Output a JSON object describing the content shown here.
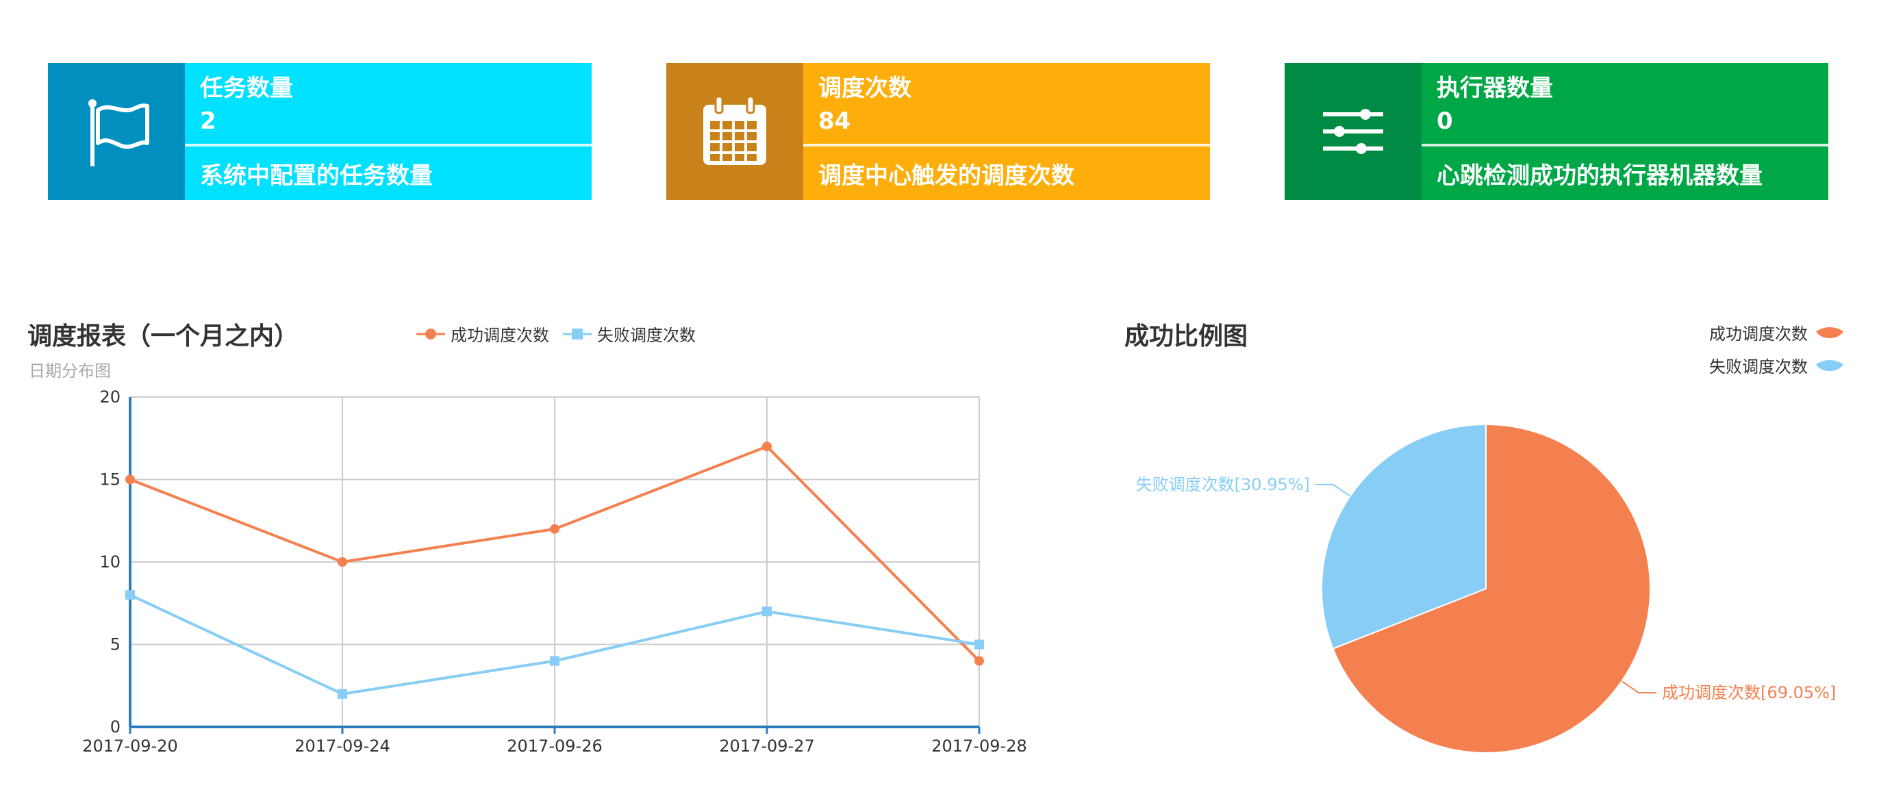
{
  "info_boxes": [
    {
      "title": "任务数量",
      "value": "2",
      "desc": "系统中配置的任务数量",
      "icon": "flag-icon"
    },
    {
      "title": "调度次数",
      "value": "84",
      "desc": "调度中心触发的调度次数",
      "icon": "calendar-icon"
    },
    {
      "title": "执行器数量",
      "value": "0",
      "desc": "心跳检测成功的执行器机器数量",
      "icon": "sliders-icon"
    }
  ],
  "colors": {
    "success": "#f5804f",
    "fail": "#87cdf5",
    "axis": "#2b7bc0"
  },
  "chart_data": [
    {
      "type": "line",
      "title": "调度报表（一个月之内）",
      "subtitle": "日期分布图",
      "x": [
        "2017-09-20",
        "2017-09-24",
        "2017-09-26",
        "2017-09-27",
        "2017-09-28"
      ],
      "series": [
        {
          "name": "成功调度次数",
          "values": [
            15,
            10,
            12,
            17,
            4
          ]
        },
        {
          "name": "失败调度次数",
          "values": [
            8,
            2,
            4,
            7,
            5
          ]
        }
      ],
      "ylim": [
        0,
        20
      ],
      "yticks": [
        "0",
        "5",
        "10",
        "15",
        "20"
      ],
      "grid": true,
      "legend": "top-center"
    },
    {
      "type": "pie",
      "title": "成功比例图",
      "slices": [
        {
          "name": "成功调度次数",
          "value": 69.05,
          "label": "成功调度次数[69.05%]"
        },
        {
          "name": "失败调度次数",
          "value": 30.95,
          "label": "失败调度次数[30.95%]"
        }
      ],
      "legend": "top-right"
    }
  ]
}
